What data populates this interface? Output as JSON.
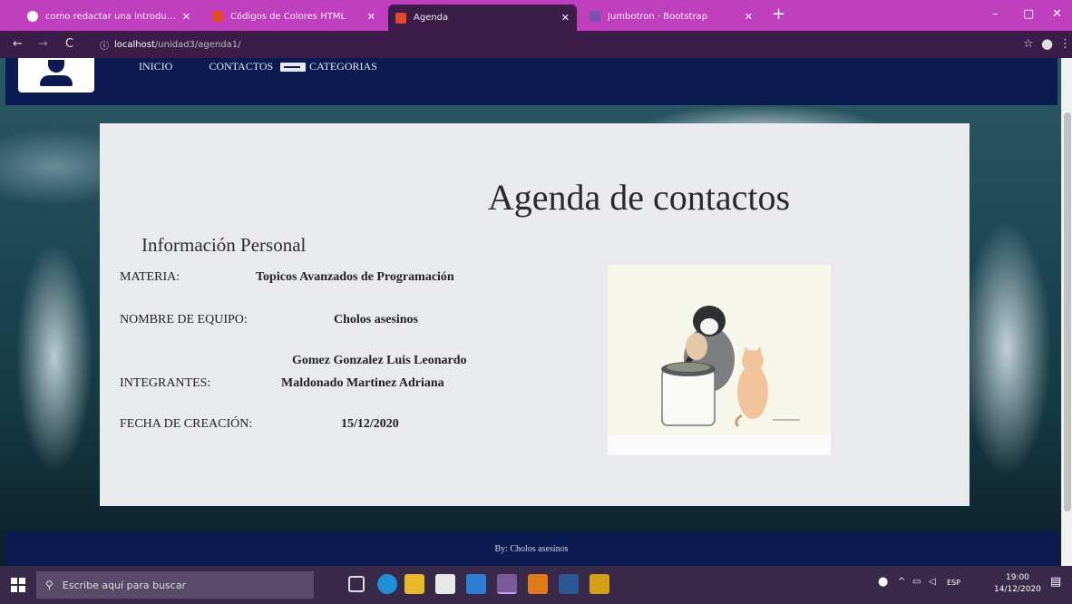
{
  "browser": {
    "tabs": [
      {
        "title": "como redactar una introducción",
        "fav_color": "#ffffff",
        "active": false
      },
      {
        "title": "Códigos de Colores HTML",
        "fav_color": "#e24a2e",
        "active": false
      },
      {
        "title": "Agenda",
        "fav_color": "#e24a2e",
        "active": true
      },
      {
        "title": "Jumbotron · Bootstrap",
        "fav_color": "#7952b3",
        "active": false
      }
    ],
    "new_tab_label": "+",
    "url_host": "localhost",
    "url_path": "/unidad3/agenda1/",
    "window_controls": [
      "–",
      "▢",
      "✕"
    ]
  },
  "site": {
    "nav": [
      {
        "label": "INICIO",
        "icon": "card-icon"
      },
      {
        "label": "CONTACTOS",
        "icon": "card-icon"
      },
      {
        "label": "CATEGORIAS",
        "icon": "list-icon"
      }
    ],
    "title": "Agenda de contactos",
    "subtitle": "Información Personal",
    "fields": {
      "materia_label": "MATERIA:",
      "materia_value": "Topicos Avanzados de Programación",
      "equipo_label": "NOMBRE DE EQUIPO:",
      "equipo_value": "Cholos asesinos",
      "integrantes_label": "INTEGRANTES:",
      "integrante_1": "Gomez Gonzalez Luis Leonardo",
      "integrante_2": "Maldonado Martinez Adriana",
      "fecha_label": "FECHA DE CREACIÓN:",
      "fecha_value": "15/12/2020"
    },
    "footer": "By: Cholos asesinos"
  },
  "taskbar": {
    "search_placeholder": "Escribe aquí para buscar",
    "language": "ESP",
    "time": "19:00",
    "date": "14/12/2020"
  },
  "colors": {
    "tab_strip": "#bf3fbf",
    "site_nav": "#0b1a50",
    "card_bg": "#e8eaed"
  }
}
